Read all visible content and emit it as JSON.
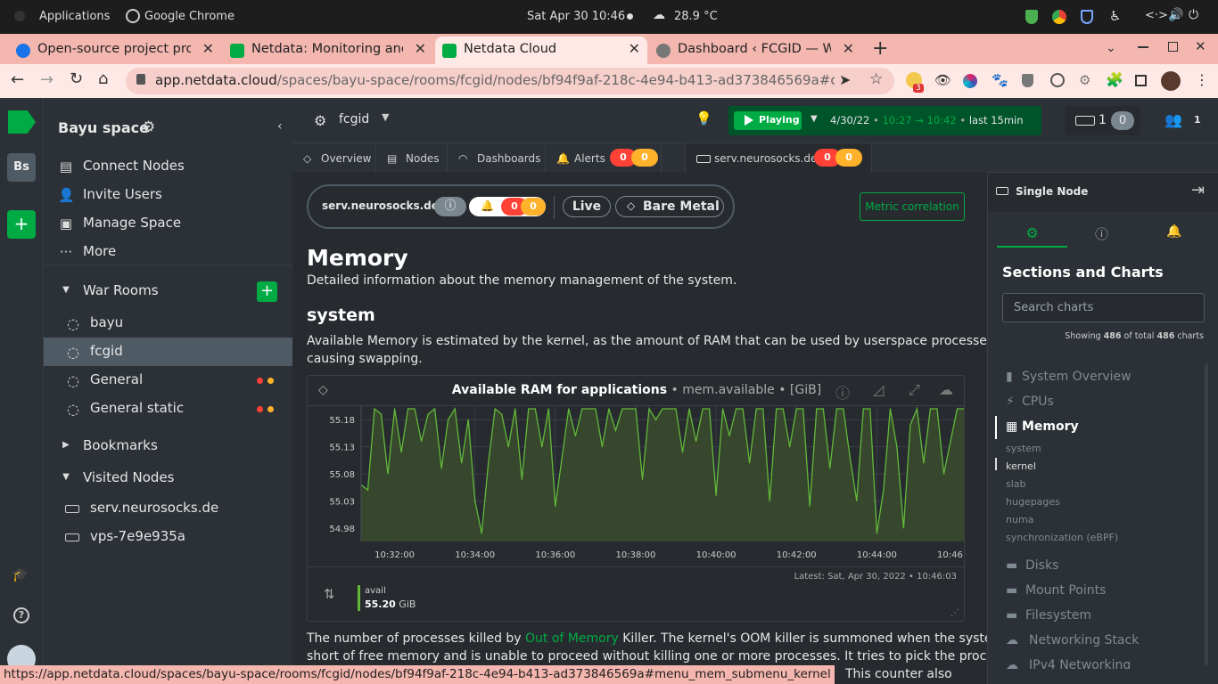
{
  "system_bar": {
    "applications": "Applications",
    "active_app": "Google Chrome",
    "datetime": "Sat Apr 30  10:46",
    "weather": "28.9 °C"
  },
  "tabs": [
    {
      "title": "Open-source project proje",
      "fav_color": "#1a73e8",
      "active": false
    },
    {
      "title": "Netdata: Monitoring and t",
      "fav_color": "#00ab44",
      "active": false
    },
    {
      "title": "Netdata Cloud",
      "fav_color": "#00ab44",
      "active": true
    },
    {
      "title": "Dashboard ‹ FCGID — Wor",
      "fav_color": "#666666",
      "active": false
    }
  ],
  "url": {
    "domain": "app.netdata.cloud",
    "path": "/spaces/bayu-space/rooms/fcgid/nodes/bf94f9af-218c-4e94-b413-ad373846569a#chartName=menu..."
  },
  "extension_badge": "3",
  "space": {
    "name": "Bayu space",
    "initials": "Bs"
  },
  "sidebar": {
    "top_items": [
      {
        "label": "Connect Nodes",
        "icon": "server-icon"
      },
      {
        "label": "Invite Users",
        "icon": "user-icon"
      },
      {
        "label": "Manage Space",
        "icon": "manage-icon"
      },
      {
        "label": "More",
        "icon": "more-icon"
      }
    ],
    "war_rooms_label": "War Rooms",
    "rooms": [
      {
        "label": "bayu",
        "alerts": false,
        "selected": false
      },
      {
        "label": "fcgid",
        "alerts": false,
        "selected": true
      },
      {
        "label": "General",
        "alerts": true,
        "selected": false
      },
      {
        "label": "General static",
        "alerts": true,
        "selected": false
      }
    ],
    "bookmarks_label": "Bookmarks",
    "visited_label": "Visited Nodes",
    "visited_nodes": [
      "serv.neurosocks.de",
      "vps-7e9e935a"
    ]
  },
  "topbar": {
    "room": "fcgid",
    "playing": "Playing",
    "date": "4/30/22",
    "time_from": "10:27",
    "time_to": "10:42",
    "range": "last 15min",
    "nodes_count": "1",
    "nodes_offline": "0",
    "users_count": "1"
  },
  "subnav": {
    "overview": "Overview",
    "nodes": "Nodes",
    "dashboards": "Dashboards",
    "alerts": "Alerts",
    "alerts_crit": "0",
    "alerts_warn": "0",
    "node_tab": "serv.neurosocks.de",
    "node_crit": "0",
    "node_warn": "0"
  },
  "node_header": {
    "name": "serv.neurosocks.de",
    "alert_crit": "0",
    "alert_warn": "0",
    "live": "Live",
    "type": "Bare Metal",
    "metric_correlation": "Metric correlation"
  },
  "content": {
    "section_title": "Memory",
    "section_desc": "Detailed information about the memory management of the system.",
    "sub_title": "system",
    "sub_desc_1": "Available Memory is estimated by the kernel, as the amount of RAM that can be used by userspace processes, without",
    "sub_desc_2": "causing swapping.",
    "oom_pre": "The number of processes killed by ",
    "oom_link": "Out of Memory",
    "oom_post": " Killer. The kernel's OOM killer is summoned when the system runs",
    "oom_line2": "short of free memory and is unable to proceed without killing one or more processes. It tries to pick the process",
    "oom_line3": "This counter also"
  },
  "chart": {
    "title_main": "Available RAM for applications",
    "title_ctx": " • mem.available • [GiB]",
    "latest_label": "Latest:",
    "latest_value": "Sat, Apr 30, 2022 • 10:46:03",
    "legend_name": "avail",
    "legend_value": "55.20",
    "legend_unit": "GiB",
    "line_color": "#62b83a"
  },
  "chart_data": {
    "type": "area",
    "title": "Available RAM for applications",
    "ylabel": "GiB",
    "ylim": [
      54.955,
      55.205
    ],
    "y_ticks": [
      "55.18",
      "55.13",
      "55.08",
      "55.03",
      "54.98"
    ],
    "y_tick_values": [
      55.18,
      55.13,
      55.08,
      55.03,
      54.98
    ],
    "x_ticks": [
      "10:32:00",
      "10:34:00",
      "10:36:00",
      "10:38:00",
      "10:40:00",
      "10:42:00",
      "10:44:00",
      "10:46:00"
    ],
    "x_start": "10:31:10",
    "x_end": "10:46:10",
    "series": [
      {
        "name": "avail",
        "x": [
          "10:31:10",
          "10:31:20",
          "10:31:30",
          "10:31:40",
          "10:31:50",
          "10:32:00",
          "10:32:10",
          "10:32:20",
          "10:32:30",
          "10:32:40",
          "10:32:50",
          "10:33:00",
          "10:33:10",
          "10:33:20",
          "10:33:30",
          "10:33:40",
          "10:33:50",
          "10:34:00",
          "10:34:10",
          "10:34:20",
          "10:34:30",
          "10:34:40",
          "10:34:50",
          "10:35:00",
          "10:35:10",
          "10:35:20",
          "10:35:30",
          "10:35:40",
          "10:35:50",
          "10:36:00",
          "10:36:10",
          "10:36:20",
          "10:36:30",
          "10:36:40",
          "10:36:50",
          "10:37:00",
          "10:37:10",
          "10:37:20",
          "10:37:30",
          "10:37:40",
          "10:37:50",
          "10:38:00",
          "10:38:10",
          "10:38:20",
          "10:38:30",
          "10:38:40",
          "10:38:50",
          "10:39:00",
          "10:39:10",
          "10:39:20",
          "10:39:30",
          "10:39:40",
          "10:39:50",
          "10:40:00",
          "10:40:10",
          "10:40:20",
          "10:40:30",
          "10:40:40",
          "10:40:50",
          "10:41:00",
          "10:41:10",
          "10:41:20",
          "10:41:30",
          "10:41:40",
          "10:41:50",
          "10:42:00",
          "10:42:10",
          "10:42:20",
          "10:42:30",
          "10:42:40",
          "10:42:50",
          "10:43:00",
          "10:43:10",
          "10:43:20",
          "10:43:30",
          "10:43:40",
          "10:43:50",
          "10:44:00",
          "10:44:10",
          "10:44:20",
          "10:44:30",
          "10:44:40",
          "10:44:50",
          "10:45:00",
          "10:45:10",
          "10:45:20",
          "10:45:30",
          "10:45:40",
          "10:45:50",
          "10:46:00",
          "10:46:10"
        ],
        "values": [
          55.06,
          55.05,
          55.2,
          55.19,
          55.08,
          55.2,
          55.12,
          55.2,
          55.2,
          55.14,
          55.19,
          55.2,
          55.09,
          55.18,
          55.2,
          55.1,
          55.18,
          55.03,
          54.97,
          55.1,
          55.2,
          55.19,
          55.13,
          55.2,
          55.07,
          55.2,
          55.2,
          55.13,
          55.2,
          55.02,
          55.11,
          55.2,
          55.15,
          55.2,
          55.2,
          55.2,
          55.13,
          55.2,
          55.16,
          55.2,
          55.2,
          55.2,
          55.07,
          55.2,
          55.18,
          55.2,
          55.2,
          55.2,
          55.12,
          55.2,
          55.14,
          55.2,
          55.2,
          55.04,
          55.2,
          55.15,
          55.2,
          55.2,
          55.1,
          55.2,
          55.2,
          55.03,
          55.2,
          55.2,
          55.13,
          55.2,
          55.2,
          55.02,
          55.2,
          55.2,
          55.09,
          55.2,
          55.2,
          55.11,
          55.03,
          55.2,
          55.2,
          54.97,
          55.05,
          55.2,
          55.13,
          54.98,
          55.17,
          55.2,
          55.1,
          55.2,
          55.2,
          55.08,
          55.14,
          55.2,
          55.2
        ]
      }
    ]
  },
  "right_panel": {
    "mode": "Single Node",
    "heading": "Sections and Charts",
    "search_placeholder": "Search charts",
    "showing_pre": "Showing",
    "showing_count": "486",
    "showing_mid": "of total",
    "showing_total": "486",
    "showing_post": "charts",
    "sections": [
      "System Overview",
      "CPUs",
      "Memory",
      "Disks",
      "Mount Points",
      "Filesystem",
      "Networking Stack",
      "IPv4 Networking"
    ],
    "memory_subs": [
      "system",
      "kernel",
      "slab",
      "hugepages",
      "numa",
      "synchronization (eBPF)"
    ]
  },
  "status_url": "https://app.netdata.cloud/spaces/bayu-space/rooms/fcgid/nodes/bf94f9af-218c-4e94-b413-ad373846569a#menu_mem_submenu_kernel"
}
